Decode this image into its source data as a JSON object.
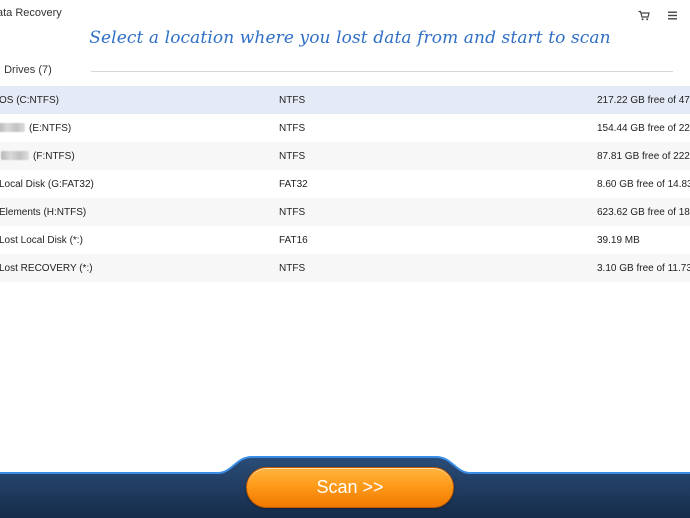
{
  "window": {
    "title": "ata Recovery"
  },
  "titlebar": {
    "icons": [
      "cart-icon",
      "menu-icon"
    ]
  },
  "heading": "Select a location where you lost data from and start to scan",
  "section": {
    "label": ": Drives (7)"
  },
  "drives": [
    {
      "name": "OS (C:NTFS)",
      "fs": "NTFS",
      "size": "217.22 GB free of 477",
      "blurred": false
    },
    {
      "name": "(E:NTFS)",
      "fs": "NTFS",
      "size": "154.44 GB free of 220",
      "blurred": true
    },
    {
      "name": "(F:NTFS)",
      "fs": "NTFS",
      "size": "87.81 GB free of 222.",
      "blurred": true
    },
    {
      "name": "Local Disk (G:FAT32)",
      "fs": "FAT32",
      "size": "8.60 GB free of 14.83",
      "blurred": false
    },
    {
      "name": "Elements (H:NTFS)",
      "fs": "NTFS",
      "size": "623.62 GB free of 186",
      "blurred": false
    },
    {
      "name": "Lost Local Disk (*:)",
      "fs": "FAT16",
      "size": "39.19 MB",
      "blurred": false
    },
    {
      "name": "Lost RECOVERY (*:)",
      "fs": "NTFS",
      "size": "3.10 GB free of 11.73",
      "blurred": false
    }
  ],
  "scan_button": {
    "label": "Scan >>"
  },
  "colors": {
    "heading": "#2f6fc6",
    "selected_row": "#e5eaf7",
    "bottom_bar": "#1e3d63",
    "bottom_bar_edge": "#2f7fd8",
    "scan_button": "#ff9a1a"
  }
}
